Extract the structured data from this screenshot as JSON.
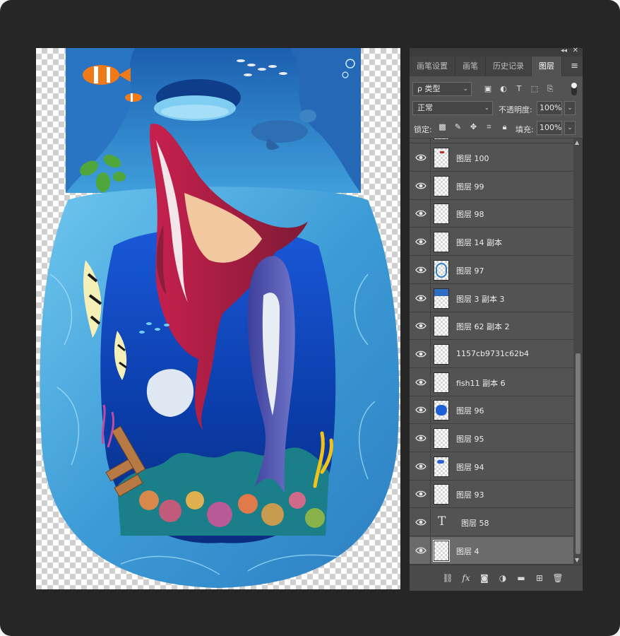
{
  "panel": {
    "tabs": [
      {
        "label": "画笔设置"
      },
      {
        "label": "画笔"
      },
      {
        "label": "历史记录"
      },
      {
        "label": "图层"
      }
    ],
    "active_tab": "图层",
    "filter": {
      "kind_label": "ρ 类型"
    },
    "blend_mode": "正常",
    "opacity_label": "不透明度:",
    "opacity_value": "100%",
    "lock_label": "锁定:",
    "fill_label": "填充:",
    "fill_value": "100%"
  },
  "layers": [
    {
      "name": "图层 100",
      "thumb": "small-red-mark"
    },
    {
      "name": "图层 99",
      "thumb": "transparent"
    },
    {
      "name": "图层 98",
      "thumb": "transparent"
    },
    {
      "name": "图层 14 副本",
      "thumb": "transparent"
    },
    {
      "name": "图层 97",
      "thumb": "blue-ring"
    },
    {
      "name": "图层 3 副本 3",
      "thumb": "blue-top"
    },
    {
      "name": "图层 62 副本 2",
      "thumb": "transparent"
    },
    {
      "name": "1157cb9731c62b4",
      "thumb": "transparent"
    },
    {
      "name": "fish11 副本 6",
      "thumb": "transparent"
    },
    {
      "name": "图层 96",
      "thumb": "blue-blob"
    },
    {
      "name": "图层 95",
      "thumb": "transparent"
    },
    {
      "name": "图层 94",
      "thumb": "small-blue-mark"
    },
    {
      "name": "图层 93",
      "thumb": "transparent"
    },
    {
      "name": "图层 58",
      "thumb": "type"
    },
    {
      "name": "图层 4",
      "thumb": "transparent",
      "selected": true
    }
  ],
  "icons": {
    "filter": [
      "image-filter-icon",
      "adjustment-filter-icon",
      "type-filter-icon",
      "shape-filter-icon",
      "smart-object-filter-icon"
    ],
    "lock": [
      "lock-transparent-pixels-icon",
      "lock-image-pixels-icon",
      "lock-position-icon",
      "lock-artboard-icon",
      "lock-all-icon"
    ],
    "bottom": [
      "link-layers-icon",
      "fx-icon",
      "add-mask-icon",
      "adjustment-layer-icon",
      "new-group-icon",
      "new-layer-icon",
      "delete-layer-icon"
    ]
  },
  "colors": {
    "app_background": "#262626",
    "panel_background": "#535353",
    "selected_row": "#6b6b6b",
    "ocean_deep": "#0b3fb5",
    "water_light": "#5ab8e6"
  },
  "scroll_position": 0.72
}
